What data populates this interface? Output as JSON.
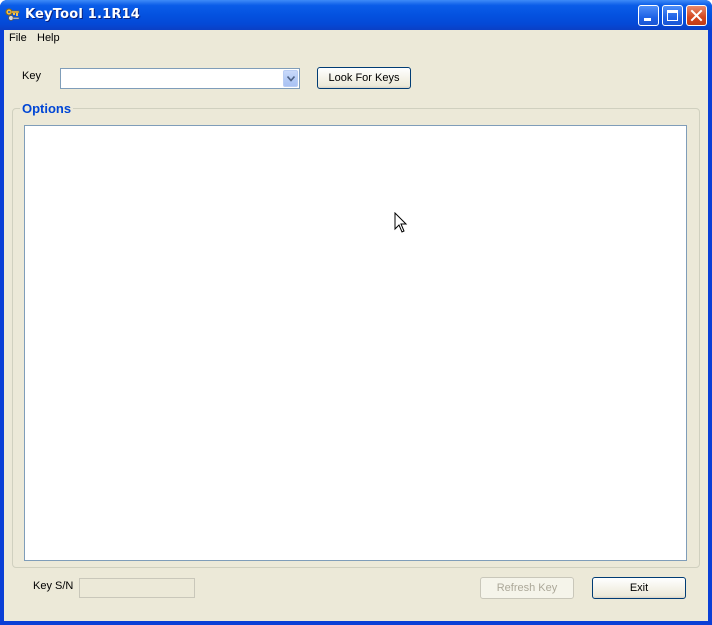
{
  "window": {
    "title": "KeyTool 1.1R14",
    "icon": "keys-icon",
    "title_color": "#0a5ce8"
  },
  "menu": {
    "items": [
      {
        "label": "File"
      },
      {
        "label": "Help"
      }
    ]
  },
  "key": {
    "label": "Key",
    "value": "",
    "look_for_keys_label": "Look For Keys"
  },
  "options": {
    "title": "Options",
    "title_color": "#0046d5"
  },
  "footer": {
    "sn_label": "Key S/N",
    "sn_value": "",
    "refresh_label": "Refresh Key",
    "refresh_enabled": false,
    "exit_label": "Exit"
  }
}
